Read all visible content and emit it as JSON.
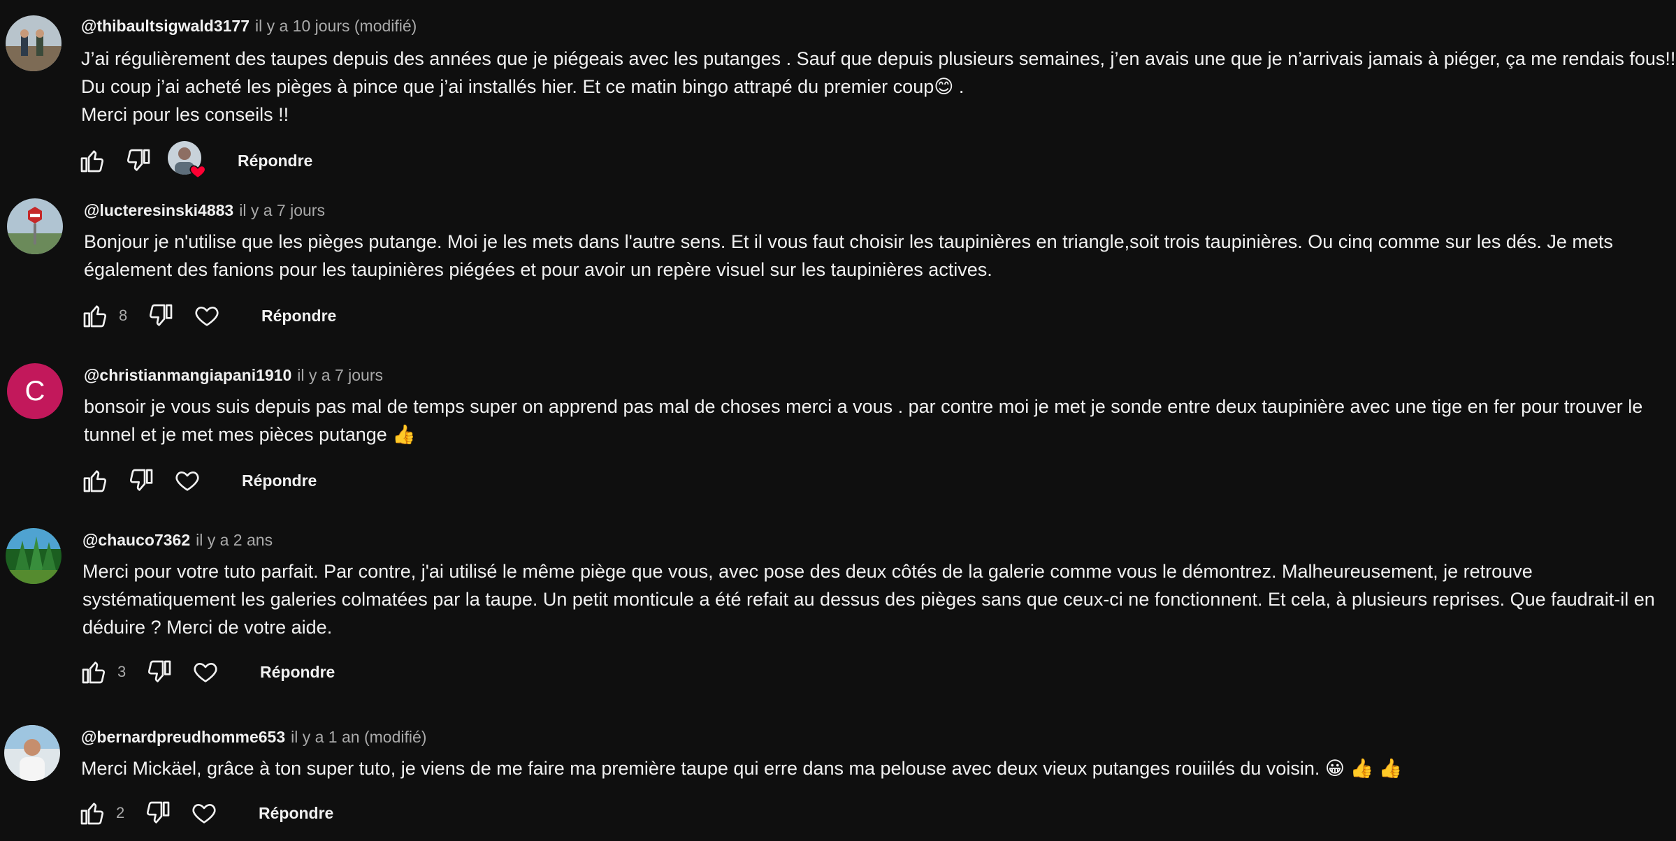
{
  "comments": [
    {
      "author": "@thibaultsigwald3177",
      "time": "il y a 10 jours (modifié)",
      "lines": [
        "J’ai régulièrement des taupes depuis des années que je piégeais avec les putanges . Sauf que depuis plusieurs semaines, j’en avais une que je n’arrivais jamais à piéger, ça me rendais fous!! Du coup j’ai acheté les pièges à pince que j’ai installés hier. Et ce matin bingo attrapé du premier coup😊 .",
        "Merci pour les conseils !!"
      ],
      "likes": "",
      "reply_label": "Répondre",
      "creator_heart": true,
      "avatar_icon": "photo-avatar-people",
      "avatar_color": "#8a9aa6"
    },
    {
      "author": "@lucteresinski4883",
      "time": "il y a 7 jours",
      "lines": [
        "Bonjour je n'utilise que les pièges putange. Moi je les mets dans l'autre sens. Et il vous faut choisir les taupinières en triangle,soit trois taupinières. Ou cinq comme sur les dés. Je mets également des fanions pour les taupinières piégées et pour avoir un repère visuel sur les taupinières actives."
      ],
      "likes": "8",
      "reply_label": "Répondre",
      "creator_heart": false,
      "avatar_icon": "photo-avatar-stop-sign",
      "avatar_color": "#9fb3c0"
    },
    {
      "author": "@christianmangiapani1910",
      "time": "il y a 7 jours",
      "lines": [
        "bonsoir je vous suis depuis pas mal de temps super  on apprend  pas mal de choses merci a vous . par contre moi je met je sonde entre deux taupinière avec une tige en fer pour trouver le tunnel et je met mes pièces putange 👍"
      ],
      "likes": "",
      "reply_label": "Répondre",
      "creator_heart": false,
      "avatar_letter": "C",
      "avatar_icon": "letter-avatar",
      "avatar_color": "#c2185b"
    },
    {
      "author": "@chauco7362",
      "time": "il y a 2 ans",
      "lines": [
        "Merci pour votre tuto parfait. Par contre, j'ai utilisé le même piège que vous, avec pose des deux côtés de la galerie comme vous le démontrez. Malheureusement, je retrouve systématiquement les galeries colmatées par la taupe. Un petit monticule a été refait au dessus des pièges sans que ceux-ci ne fonctionnent. Et cela, à plusieurs reprises. Que faudrait-il en déduire ? Merci de votre aide."
      ],
      "likes": "3",
      "reply_label": "Répondre",
      "creator_heart": false,
      "avatar_icon": "photo-avatar-forest",
      "avatar_color": "#2e7d32"
    },
    {
      "author": "@bernardpreudhomme653",
      "time": "il y a 1 an (modifié)",
      "lines": [
        "Merci Mickäel, grâce à ton super tuto, je viens de me faire ma première taupe qui erre dans ma pelouse avec deux vieux putanges rouiilés du voisin. 😀 👍 👍"
      ],
      "likes": "2",
      "reply_label": "Répondre",
      "creator_heart": false,
      "avatar_icon": "photo-avatar-man",
      "avatar_color": "#cfd8dc"
    }
  ],
  "colors": {
    "background": "#0f0f0f",
    "text": "#f1f1f1",
    "secondary": "#aaaaaa",
    "heart": "#ff0033"
  }
}
